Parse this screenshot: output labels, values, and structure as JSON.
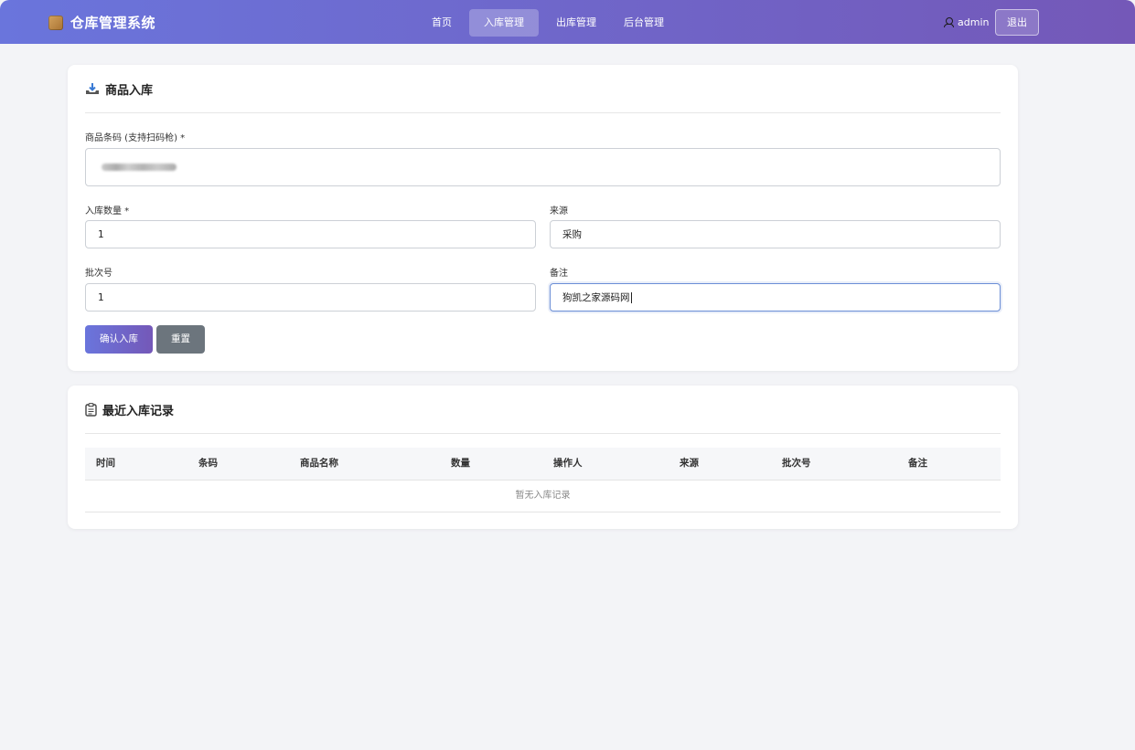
{
  "app": {
    "title": "仓库管理系统"
  },
  "nav": {
    "links": [
      {
        "label": "首页",
        "active": false
      },
      {
        "label": "入库管理",
        "active": true
      },
      {
        "label": "出库管理",
        "active": false
      },
      {
        "label": "后台管理",
        "active": false
      }
    ],
    "user": "admin",
    "logout_label": "退出"
  },
  "inbound_form": {
    "title": "商品入库",
    "barcode_label": "商品条码 (支持扫码枪) *",
    "quantity_label": "入库数量 *",
    "quantity_value": "1",
    "source_label": "来源",
    "source_value": "采购",
    "batch_label": "批次号",
    "batch_value": "1",
    "remark_label": "备注",
    "remark_value": "狗凯之家源码网",
    "confirm_label": "确认入库",
    "reset_label": "重置"
  },
  "records": {
    "title": "最近入库记录",
    "columns": [
      "时间",
      "条码",
      "商品名称",
      "数量",
      "操作人",
      "来源",
      "批次号",
      "备注"
    ],
    "empty_text": "暂无入库记录"
  },
  "colors": {
    "accent_start": "#6a75dc",
    "accent_end": "#7458b8",
    "secondary_button": "#6c757d",
    "page_bg": "#f3f4f7"
  },
  "icons": {
    "brand": "box-icon",
    "inbound": "inbox-tray-icon",
    "records": "clipboard-icon",
    "user": "user-icon"
  }
}
